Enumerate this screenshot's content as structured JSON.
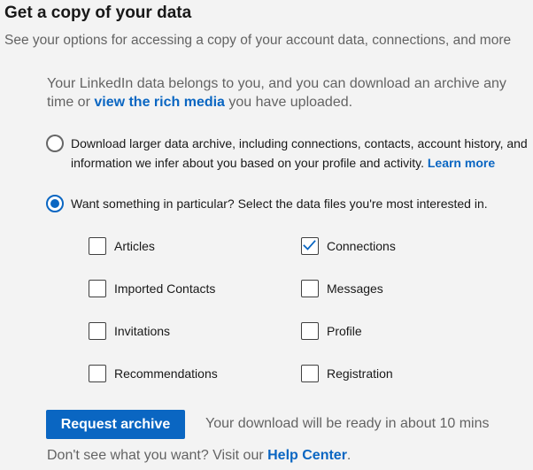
{
  "header": {
    "title": "Get a copy of your data",
    "subtitle": "See your options for accessing a copy of your account data, connections, and more"
  },
  "intro": {
    "text_before": "Your LinkedIn data belongs to you, and you can download an archive any time or ",
    "link": "view the rich media",
    "text_after": " you have uploaded."
  },
  "options": {
    "full_archive": {
      "label": "Download larger data archive, including connections, contacts, account history, and information we infer about you based on your profile and activity. ",
      "link": "Learn more",
      "selected": false
    },
    "particular": {
      "label": "Want something in particular? Select the data files you're most interested in.",
      "selected": true
    }
  },
  "checkboxes": [
    {
      "label": "Articles",
      "checked": false
    },
    {
      "label": "Connections",
      "checked": true
    },
    {
      "label": "Imported Contacts",
      "checked": false
    },
    {
      "label": "Messages",
      "checked": false
    },
    {
      "label": "Invitations",
      "checked": false
    },
    {
      "label": "Profile",
      "checked": false
    },
    {
      "label": "Recommendations",
      "checked": false
    },
    {
      "label": "Registration",
      "checked": false
    }
  ],
  "actions": {
    "request_label": "Request archive",
    "ready_text": "Your download will be ready in about 10 mins"
  },
  "footer": {
    "text_before": "Don't see what you want? Visit our ",
    "link": "Help Center",
    "text_after": "."
  },
  "colors": {
    "accent": "#0a66c2",
    "background": "#f3f3f3"
  }
}
